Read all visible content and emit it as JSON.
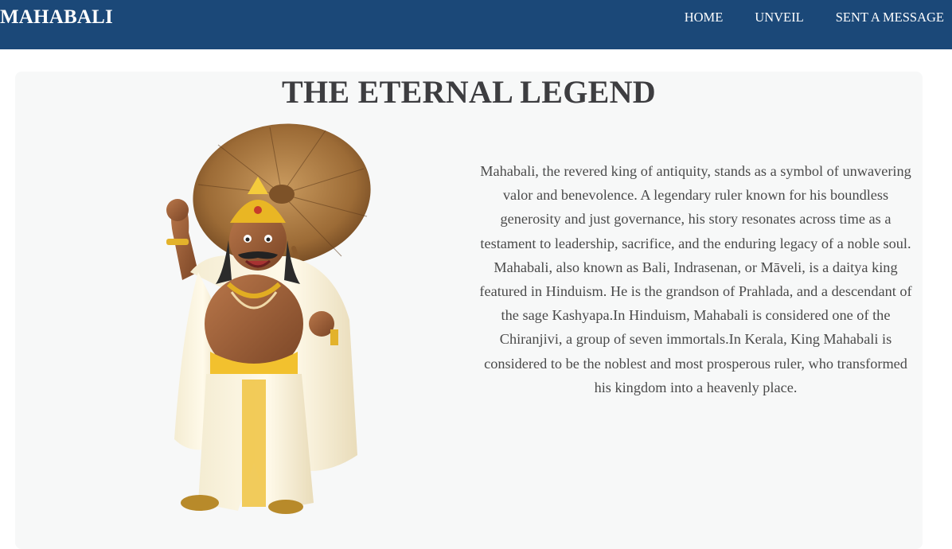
{
  "nav": {
    "brand": "MAHABALI",
    "links": [
      "HOME",
      "UNVEIL",
      "SENT A MESSAGE"
    ]
  },
  "main": {
    "title": "THE ETERNAL LEGEND",
    "paragraph_1": "Mahabali, the revered king of antiquity, stands as a symbol of unwavering valor and benevolence. A legendary ruler known for his boundless generosity and just governance, his story resonates across time as a testament to leadership, sacrifice, and the enduring legacy of a noble soul.",
    "paragraph_2": "Mahabali, also known as Bali, Indrasenan, or Māveli, is a daitya king featured in Hinduism. He is the grandson of Prahlada, and a descendant of the sage Kashyapa.In Hinduism, Mahabali is considered one of the Chiranjivi, a group of seven immortals.In Kerala, King Mahabali is considered to be the noblest and most prosperous ruler, who transformed his kingdom into a heavenly place."
  },
  "colors": {
    "navbar": "#1b4878",
    "card": "#f7f8f8",
    "title": "#3d3d40",
    "text": "#4a4a4a"
  },
  "illustration": {
    "icon": "mahabali-king-illustration"
  }
}
